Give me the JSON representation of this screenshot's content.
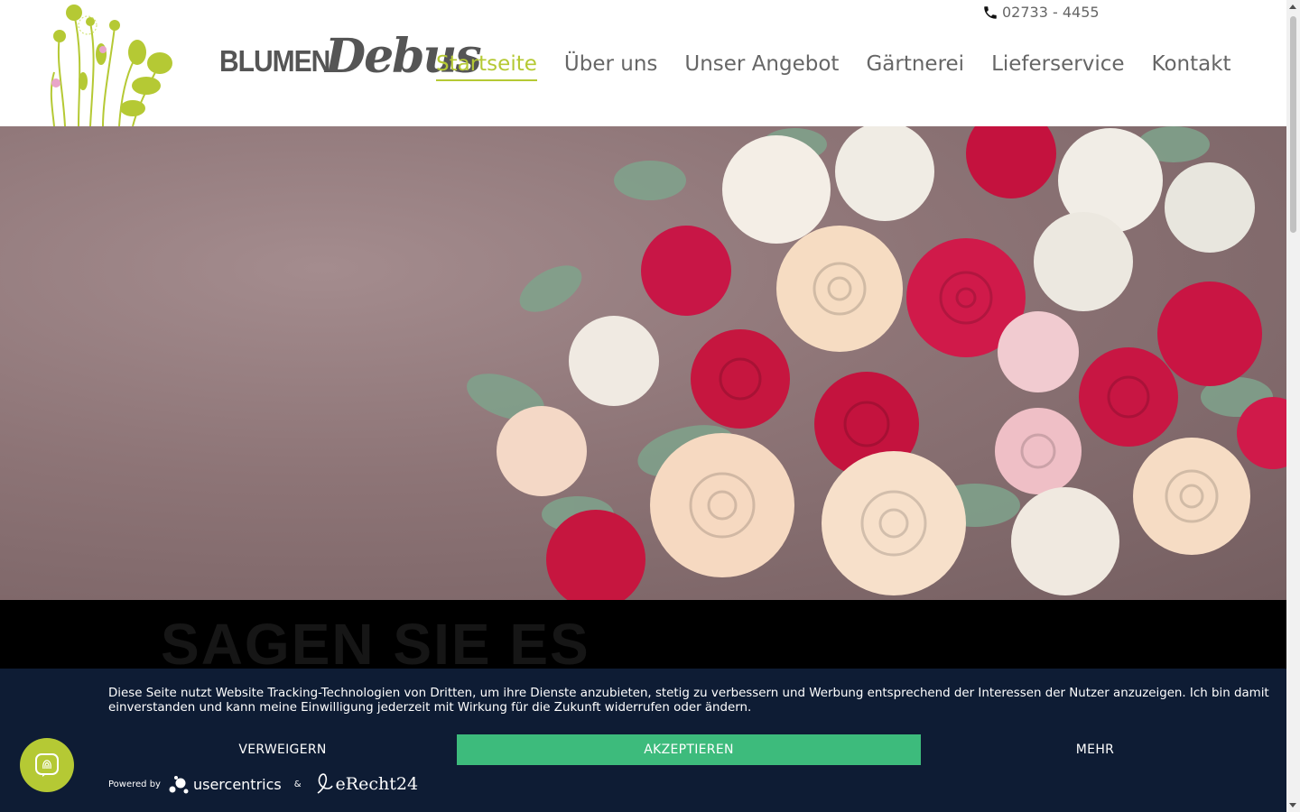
{
  "header": {
    "phone": "02733 - 4455",
    "logo_word": "BLUMEN",
    "logo_script": "Debus",
    "nav": [
      {
        "label": "Startseite",
        "active": true
      },
      {
        "label": "Über uns",
        "active": false
      },
      {
        "label": "Unser Angebot",
        "active": false
      },
      {
        "label": "Gärtnerei",
        "active": false
      },
      {
        "label": "Lieferservice",
        "active": false
      },
      {
        "label": "Kontakt",
        "active": false
      }
    ]
  },
  "band": {
    "title": "SAGEN SIE ES"
  },
  "cookie": {
    "text": "Diese Seite nutzt Website Tracking-Technologien von Dritten, um ihre Dienste anzubieten, stetig zu verbessern und Werbung entsprechend der Interessen der Nutzer anzuzeigen. Ich bin damit einverstanden und kann meine Einwilligung jederzeit mit Wirkung für die Zukunft widerrufen oder ändern.",
    "deny_label": "VERWEIGERN",
    "accept_label": "AKZEPTIEREN",
    "more_label": "MEHR",
    "powered_by": "Powered by",
    "brand_1": "usercentrics",
    "amp": "&",
    "brand_2": "eRecht24"
  },
  "colors": {
    "accent": "#b5c934",
    "accept": "#3dbb7c",
    "banner_bg": "#0e1c34"
  }
}
